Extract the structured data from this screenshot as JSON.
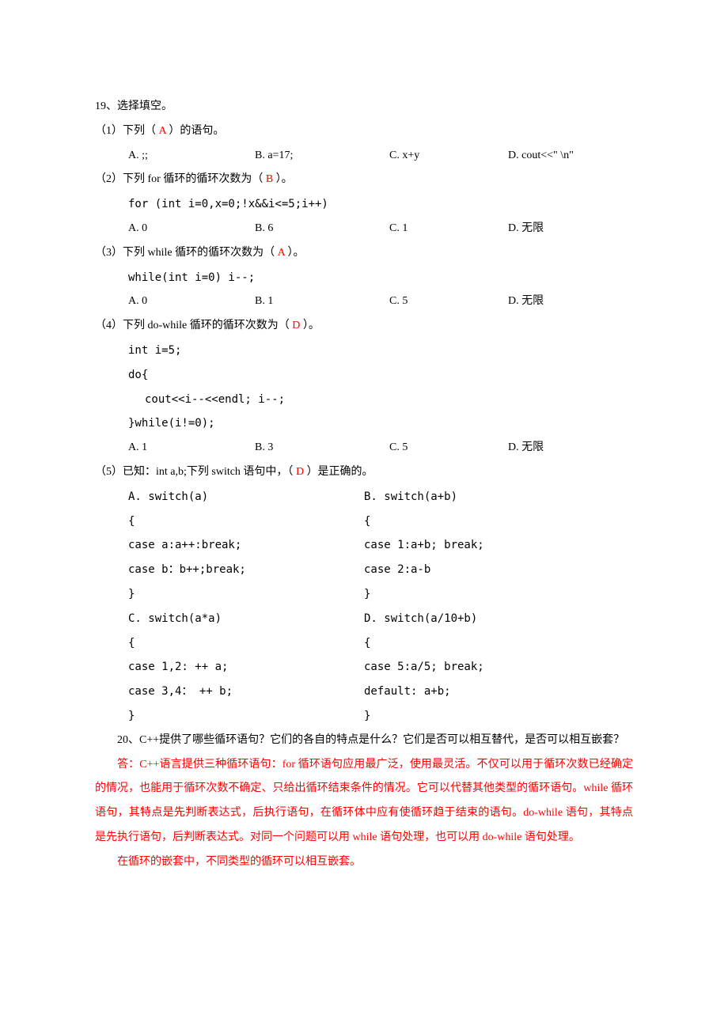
{
  "q19": {
    "title": "19、选择填空。",
    "sub1": {
      "stem_pre": "（1）下列（ ",
      "ans": "A",
      "stem_post": " ）的语句。",
      "a": "A.  ;;",
      "b": "B. a=17;",
      "c": "C. x+y",
      "d": "D. cout<<\" \\n\""
    },
    "sub2": {
      "stem_pre": "（2）下列 for 循环的循环次数为（ ",
      "ans": "B",
      "stem_post": " ）。",
      "code": "for (int i=0,x=0;!x&&i<=5;i++)",
      "a": "A. 0",
      "b": "B. 6",
      "c": "C. 1",
      "d": "D. 无限"
    },
    "sub3": {
      "stem_pre": "（3）下列 while 循环的循环次数为（ ",
      "ans": "A",
      "stem_post": " ）。",
      "code": "while(int i=0) i--;",
      "a": "A. 0",
      "b": "B. 1",
      "c": "C. 5",
      "d": "D. 无限"
    },
    "sub4": {
      "stem_pre": "（4）下列 do-while 循环的循环次数为（ ",
      "ans": "D",
      "stem_post": "  ）。",
      "code1": "int i=5;",
      "code2": "do{",
      "code3": "  cout<<i--<<endl;   i--;",
      "code4": "}while(i!=0);",
      "a": "A. 1",
      "b": "B. 3",
      "c": "C. 5",
      "d": "D. 无限"
    },
    "sub5": {
      "stem_pre": "（5）已知：int a,b;下列 switch 语句中，（ ",
      "ans": "D",
      "stem_post": "  ）是正确的。",
      "a": {
        "l1": "A. switch(a)",
        "l2": "  {",
        "l3": "     case a:a++:break;",
        "l4": "     case b：b++;break;",
        "l5": "   }"
      },
      "b": {
        "l1": "B. switch(a+b)",
        "l2": "  {",
        "l3": "     case 1:a+b;     break;",
        "l4": "    case 2:a-b",
        "l5": "  }"
      },
      "c": {
        "l1": "C. switch(a*a)",
        "l2": "  {",
        "l3": "     case 1,2: ++ a;",
        "l4": "     case 3,4： ++ b;",
        "l5": "   }"
      },
      "d": {
        "l1": "D. switch(a/10+b)",
        "l2": "  {",
        "l3": "      case 5:a/5; break;",
        "l4": "      default: a+b;",
        "l5": "   }"
      }
    }
  },
  "q20": {
    "question": "20、C++提供了哪些循环语句？它们的各自的特点是什么？它们是否可以相互替代，是否可以相互嵌套？",
    "ans1": "答：C++语言提供三种循环语句：for 循环语句应用最广泛，使用最灵活。不仅可以用于循环次数已经确定的情况，也能用于循环次数不确定、只给出循环结束条件的情况。它可以代替其他类型的循环语句。while 循环语句，其特点是先判断表达式，后执行语句，在循环体中应有使循环趋于结束的语句。do-while 语句，其特点是先执行语句，后判断表达式。对同一个问题可以用 while 语句处理，也可以用 do-while 语句处理。",
    "ans2": "在循环的嵌套中，不同类型的循环可以相互嵌套。"
  }
}
